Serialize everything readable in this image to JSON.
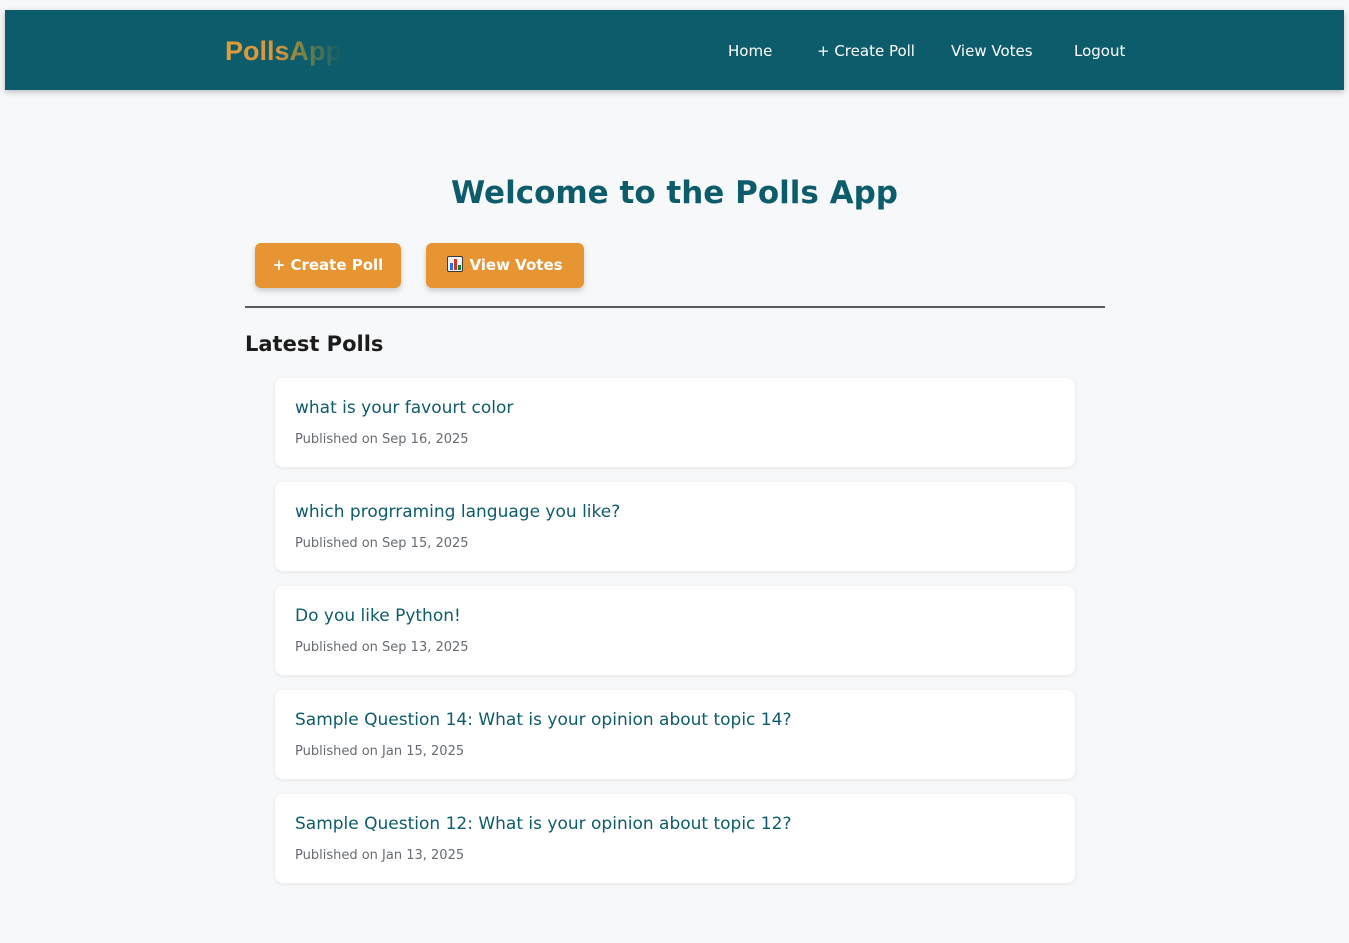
{
  "navbar": {
    "brand": "PollsApp",
    "links": {
      "home": "Home",
      "create_poll": "+ Create Poll",
      "view_votes": "View Votes",
      "logout": "Logout"
    }
  },
  "main": {
    "title": "Welcome to the Polls App",
    "actions": {
      "create_poll": "+ Create Poll",
      "view_votes": "View Votes",
      "view_votes_icon": "bar-chart-icon"
    },
    "section_title": "Latest Polls",
    "polls": [
      {
        "question": "what is your favourt color",
        "published": "Published on Sep 16, 2025"
      },
      {
        "question": "which progrraming language you like?",
        "published": "Published on Sep 15, 2025"
      },
      {
        "question": "Do you like Python!",
        "published": "Published on Sep 13, 2025"
      },
      {
        "question": "Sample Question 14: What is your opinion about topic 14?",
        "published": "Published on Jan 15, 2025"
      },
      {
        "question": "Sample Question 12: What is your opinion about topic 12?",
        "published": "Published on Jan 13, 2025"
      }
    ]
  },
  "colors": {
    "primary": "#0d5c6b",
    "accent": "#e69532",
    "background": "#f6f8fa"
  }
}
